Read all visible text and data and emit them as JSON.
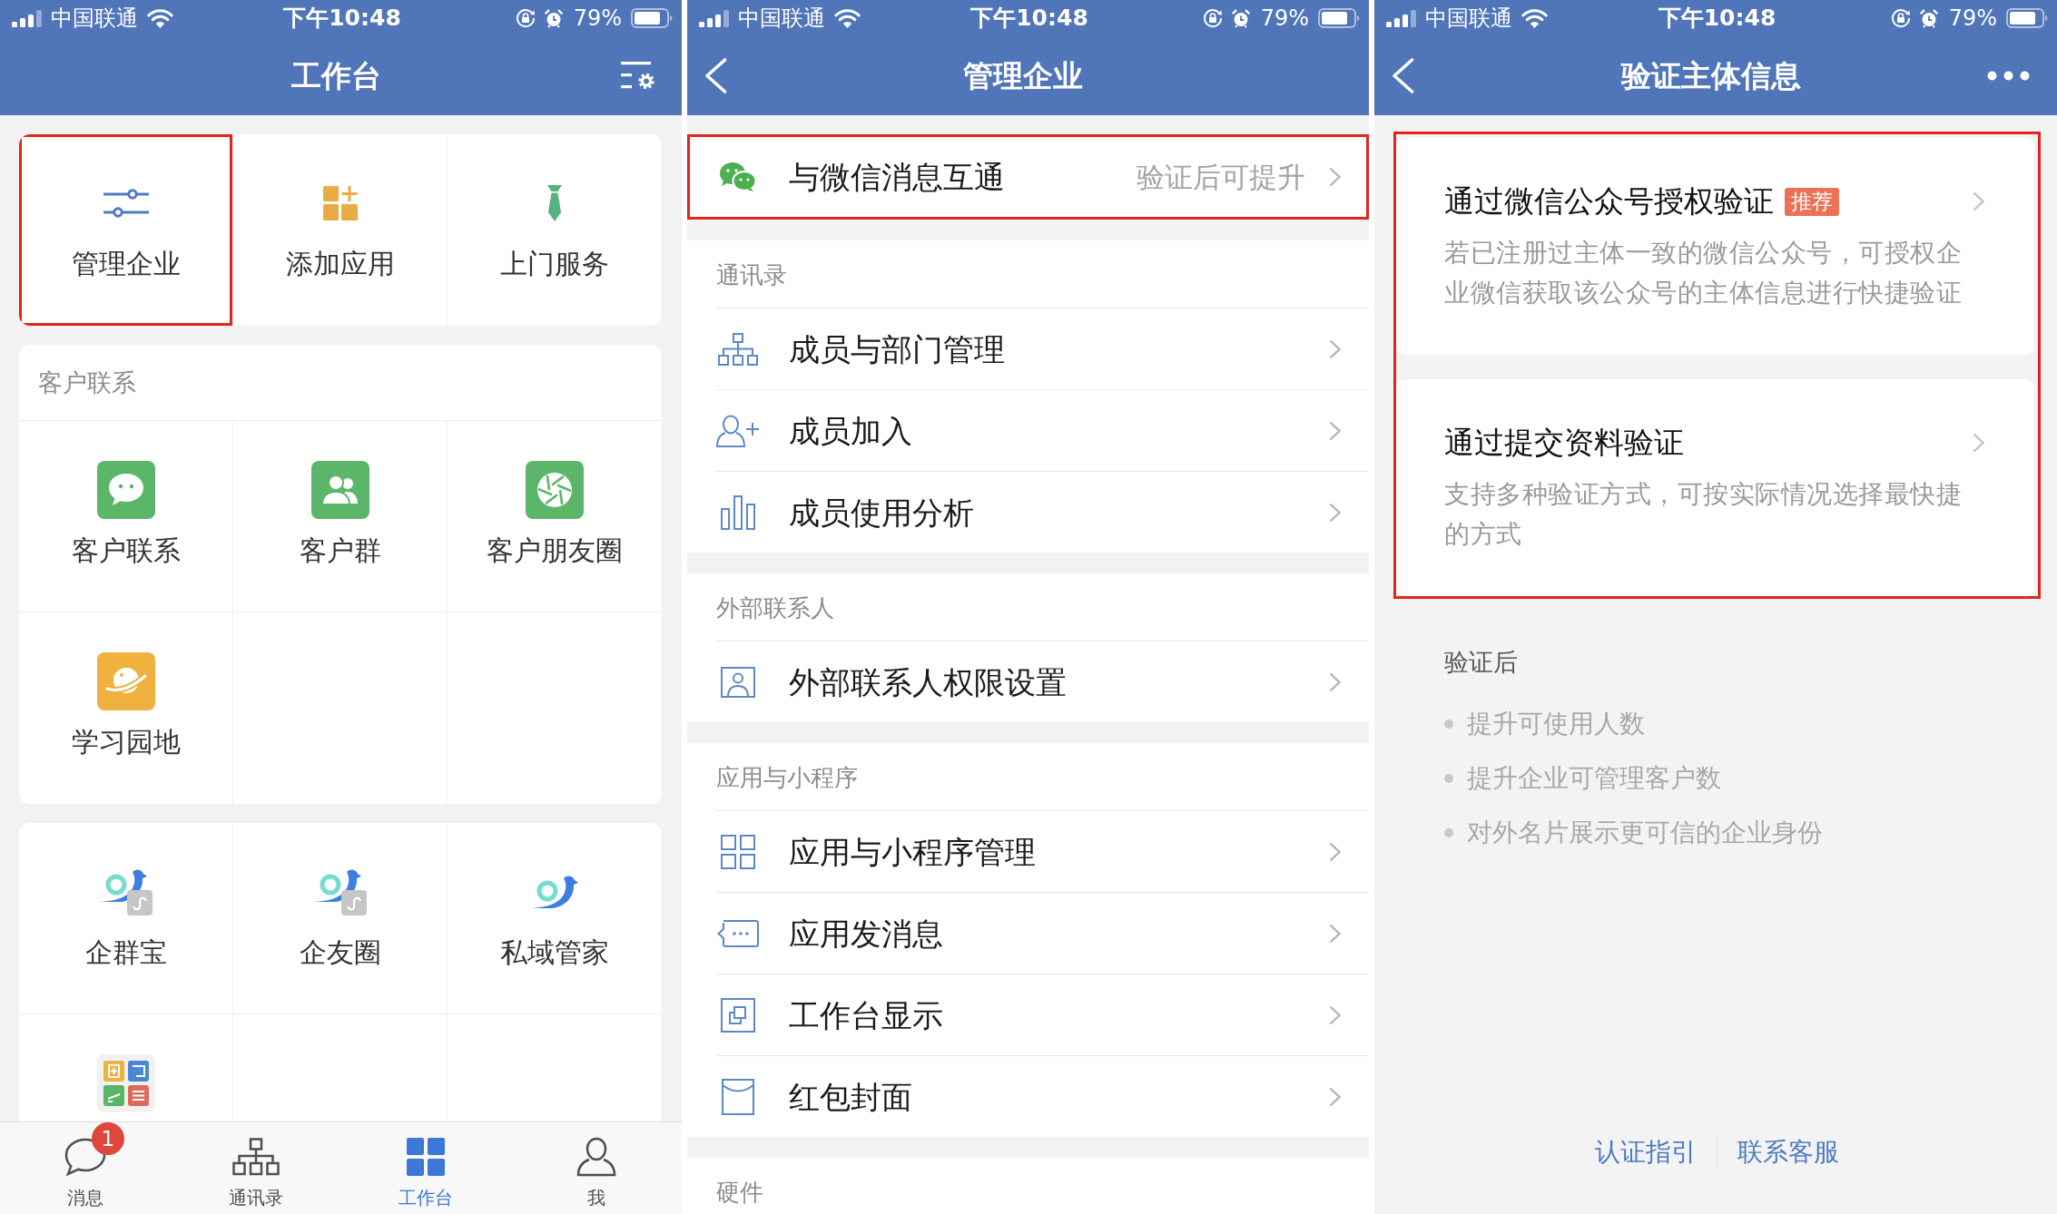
{
  "workbench": {
    "status_bar": {
      "carrier": "中国联通",
      "time": "下午10:48",
      "battery": "79%"
    },
    "title": "工作台",
    "cards": [
      {
        "items": [
          {
            "label": "管理企业",
            "kind": "sliders",
            "highlighted": true
          },
          {
            "label": "添加应用",
            "kind": "add",
            "highlighted": false
          },
          {
            "label": "上门服务",
            "kind": "tie",
            "highlighted": false
          }
        ]
      },
      {
        "header": "客户联系",
        "items": [
          {
            "label": "客户联系",
            "kind": "chat",
            "highlighted": false
          },
          {
            "label": "客户群",
            "kind": "people",
            "highlighted": false
          },
          {
            "label": "客户朋友圈",
            "kind": "aperture",
            "highlighted": false
          },
          {
            "label": "学习园地",
            "kind": "planet",
            "highlighted": false
          }
        ]
      },
      {
        "items": [
          {
            "label": "企群宝",
            "kind": "miniapp",
            "highlighted": false
          },
          {
            "label": "企友圈",
            "kind": "miniapp",
            "highlighted": false
          },
          {
            "label": "私域管家",
            "kind": "bird",
            "highlighted": false
          },
          {
            "kind": "tools",
            "highlighted": false
          }
        ]
      }
    ],
    "tabs": [
      {
        "label": "消息",
        "kind": "chat",
        "selected": false,
        "badge": "1"
      },
      {
        "label": "通讯录",
        "kind": "org",
        "selected": false
      },
      {
        "label": "工作台",
        "kind": "grid",
        "selected": true
      },
      {
        "label": "我",
        "kind": "person",
        "selected": false
      }
    ]
  },
  "manage_enterprise": {
    "status_bar": {
      "carrier": "中国联通",
      "time": "下午10:48",
      "battery": "79%"
    },
    "title": "管理企业",
    "feature": {
      "label": "与微信消息互通",
      "value": "验证后可提升",
      "highlighted": true
    },
    "sections": [
      {
        "header": "通讯录",
        "items": [
          {
            "label": "成员与部门管理",
            "kind": "org"
          },
          {
            "label": "成员加入",
            "kind": "adduser"
          },
          {
            "label": "成员使用分析",
            "kind": "bars"
          }
        ]
      },
      {
        "header": "外部联系人",
        "items": [
          {
            "label": "外部联系人权限设置",
            "kind": "contact"
          }
        ]
      },
      {
        "header": "应用与小程序",
        "items": [
          {
            "label": "应用与小程序管理",
            "kind": "grid"
          },
          {
            "label": "应用发消息",
            "kind": "message"
          },
          {
            "label": "工作台显示",
            "kind": "window"
          },
          {
            "label": "红包封面",
            "kind": "envelope"
          }
        ]
      },
      {
        "header": "硬件"
      }
    ]
  },
  "verify_subject": {
    "status_bar": {
      "carrier": "中国联通",
      "time": "下午10:48",
      "battery": "79%"
    },
    "title": "验证主体信息",
    "options": {
      "highlighted": true,
      "items": [
        {
          "title": "通过微信公众号授权验证",
          "badge": "推荐",
          "description": "若已注册过主体一致的微信公众号，可授权企业微信获取该公众号的主体信息进行快捷验证"
        },
        {
          "title": "通过提交资料验证",
          "description": "支持多种验证方式，可按实际情况选择最快捷的方式"
        }
      ]
    },
    "benefits": {
      "title": "验证后",
      "items": [
        "提升可使用人数",
        "提升企业可管理客户数",
        "对外名片展示更可信的企业身份"
      ]
    },
    "links": [
      "认证指引",
      "联系客服"
    ]
  }
}
